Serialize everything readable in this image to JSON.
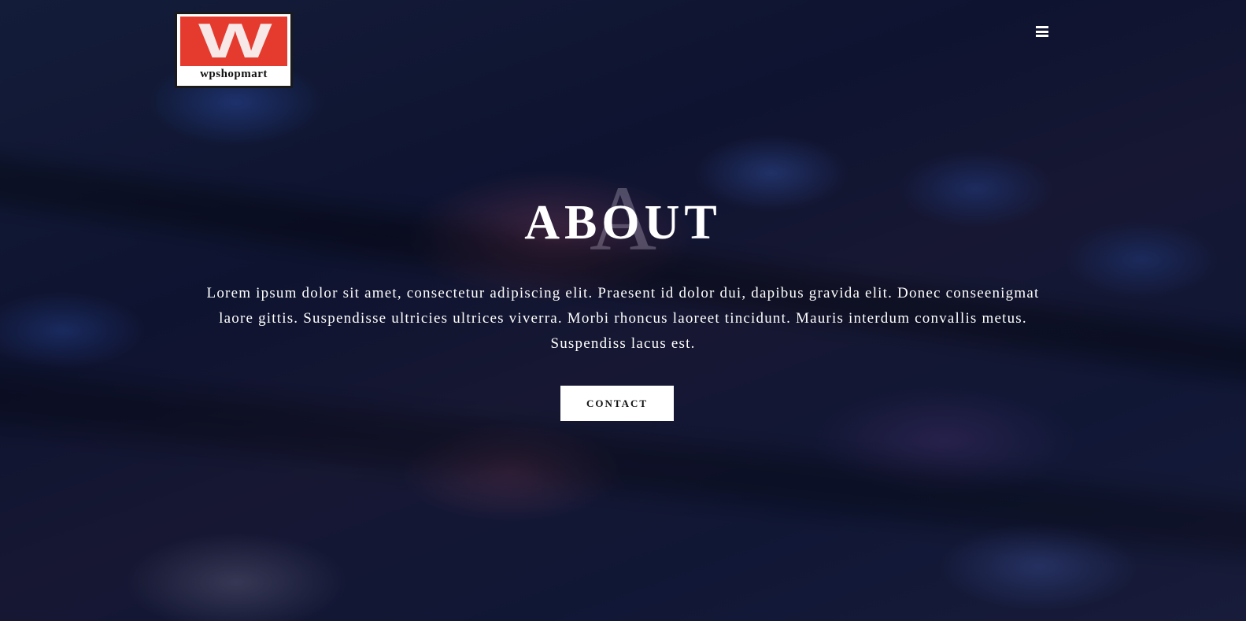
{
  "header": {
    "logo_text": "wpshopmart",
    "logo_mark": "W",
    "menu_icon": "hamburger-menu-icon"
  },
  "hero": {
    "watermark_letter": "A",
    "title": "ABOUT",
    "description": "Lorem ipsum dolor sit amet, consectetur adipiscing elit. Praesent id dolor dui, dapibus gravida elit. Donec conseenigmat laore gittis. Suspendisse ultricies ultrices viverra. Morbi rhoncus laoreet tincidunt. Mauris interdum convallis metus. Suspendiss lacus est.",
    "button_label": "CONTACT"
  },
  "colors": {
    "logo_red": "#e53a2e",
    "button_bg": "#ffffff",
    "text": "#ffffff"
  }
}
